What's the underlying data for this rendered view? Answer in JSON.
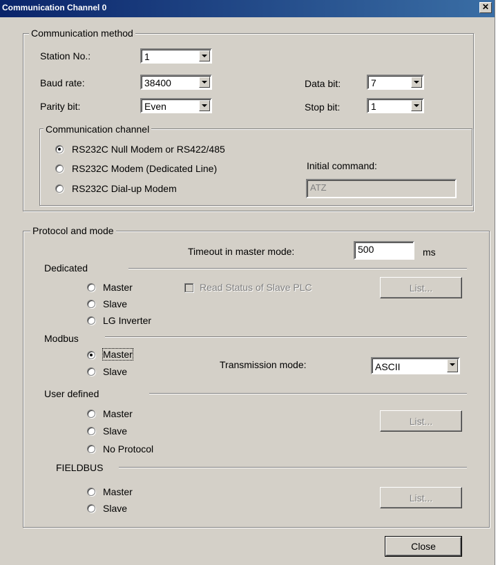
{
  "window": {
    "title": "Communication Channel 0",
    "close_glyph": "✕"
  },
  "comm_method": {
    "legend": "Communication method",
    "station_label": "Station No.:",
    "station_value": "1",
    "baud_label": "Baud rate:",
    "baud_value": "38400",
    "parity_label": "Parity bit:",
    "parity_value": "Even",
    "databit_label": "Data bit:",
    "databit_value": "7",
    "stopbit_label": "Stop bit:",
    "stopbit_value": "1"
  },
  "comm_channel": {
    "legend": "Communication channel",
    "options": [
      "RS232C Null Modem or RS422/485",
      "RS232C Modem (Dedicated Line)",
      "RS232C Dial-up Modem"
    ],
    "selected": 0,
    "initial_command_label": "Initial command:",
    "initial_command_value": "ATZ"
  },
  "protocol": {
    "legend": "Protocol and mode",
    "timeout_label": "Timeout in master mode:",
    "timeout_value": "500",
    "timeout_unit": "ms",
    "dedicated": {
      "label": "Dedicated",
      "options": [
        "Master",
        "Slave",
        "LG Inverter"
      ],
      "read_status_label": "Read Status of Slave PLC",
      "list_label": "List..."
    },
    "modbus": {
      "label": "Modbus",
      "options": [
        "Master",
        "Slave"
      ],
      "selected": 0,
      "transmission_label": "Transmission mode:",
      "transmission_value": "ASCII"
    },
    "user_defined": {
      "label": "User defined",
      "options": [
        "Master",
        "Slave",
        "No Protocol"
      ],
      "list_label": "List..."
    },
    "fieldbus": {
      "label": "FIELDBUS",
      "options": [
        "Master",
        "Slave"
      ],
      "list_label": "List..."
    }
  },
  "buttons": {
    "close_label": "Close"
  }
}
